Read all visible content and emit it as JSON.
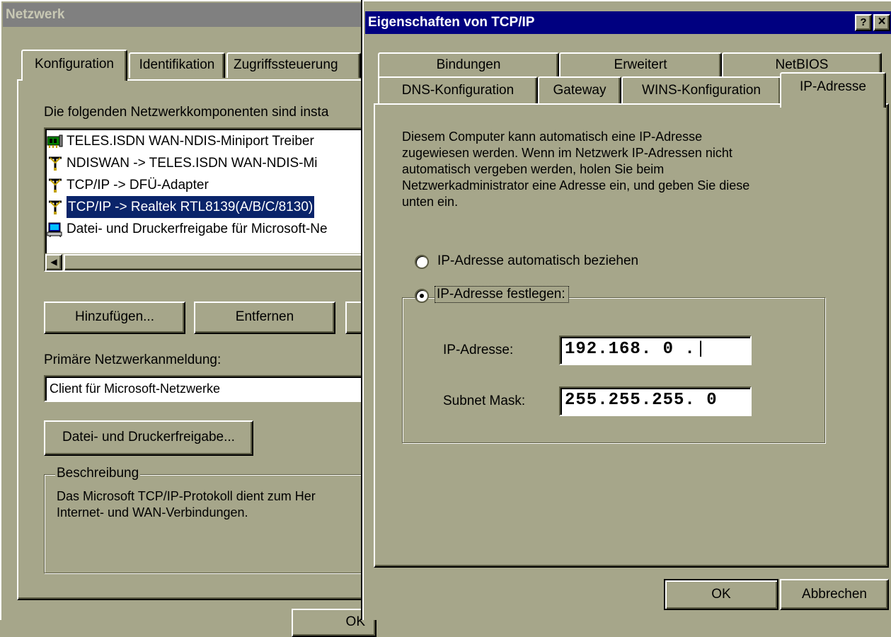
{
  "netzwerk": {
    "title": "Netzwerk",
    "tabs": [
      "Konfiguration",
      "Identifikation",
      "Zugriffssteuerung"
    ],
    "components_label": "Die folgenden Netzwerkkomponenten sind insta",
    "components": [
      {
        "label": "TELES.ISDN WAN-NDIS-Miniport Treiber",
        "icon": "network-adapter-icon",
        "selected": false
      },
      {
        "label": "NDISWAN -> TELES.ISDN WAN-NDIS-Mi",
        "icon": "protocol-icon",
        "selected": false
      },
      {
        "label": "TCP/IP -> DFÜ-Adapter",
        "icon": "protocol-icon",
        "selected": false
      },
      {
        "label": "TCP/IP -> Realtek RTL8139(A/B/C/8130)",
        "icon": "protocol-icon",
        "selected": true
      },
      {
        "label": "Datei- und Druckerfreigabe für Microsoft-Ne",
        "icon": "file-printer-sharing-icon",
        "selected": false
      }
    ],
    "add_button": "Hinzufügen...",
    "remove_button": "Entfernen",
    "primary_logon_label": "Primäre Netzwerkanmeldung:",
    "primary_logon_value": "Client für Microsoft-Netzwerke",
    "file_print_button": "Datei- und Druckerfreigabe...",
    "description_label": "Beschreibung",
    "description_line1": "Das Microsoft TCP/IP-Protokoll dient zum Her",
    "description_line2": "Internet- und WAN-Verbindungen.",
    "ok_partial": "OK"
  },
  "tcpip": {
    "title": "Eigenschaften von TCP/IP",
    "help_button": "?",
    "close_button": "×",
    "tabs_back": [
      "Bindungen",
      "Erweitert",
      "NetBIOS"
    ],
    "tabs_front": [
      "DNS-Konfiguration",
      "Gateway",
      "WINS-Konfiguration",
      "IP-Adresse"
    ],
    "active_tab": "IP-Adresse",
    "info_lines": [
      "Diesem Computer kann automatisch eine IP-Adresse",
      "zugewiesen werden. Wenn im Netzwerk IP-Adressen nicht",
      "automatisch vergeben werden, holen Sie beim",
      "Netzwerkadministrator eine Adresse ein, und geben Sie diese",
      "unten ein."
    ],
    "radio_auto": "IP-Adresse automatisch beziehen",
    "radio_manual": "IP-Adresse festlegen:",
    "selected_option": "IP-Adresse festlegen:",
    "ip_label": "IP-Adresse:",
    "ip_value": "192.168. 0 .",
    "mask_label": "Subnet Mask:",
    "mask_value": "255.255.255. 0",
    "ok_button": "OK",
    "cancel_button": "Abbrechen"
  },
  "colors": {
    "face": "#a6a68a",
    "inactive_title": "#808080",
    "active_title": "#000080",
    "selection": "#0a246a"
  }
}
